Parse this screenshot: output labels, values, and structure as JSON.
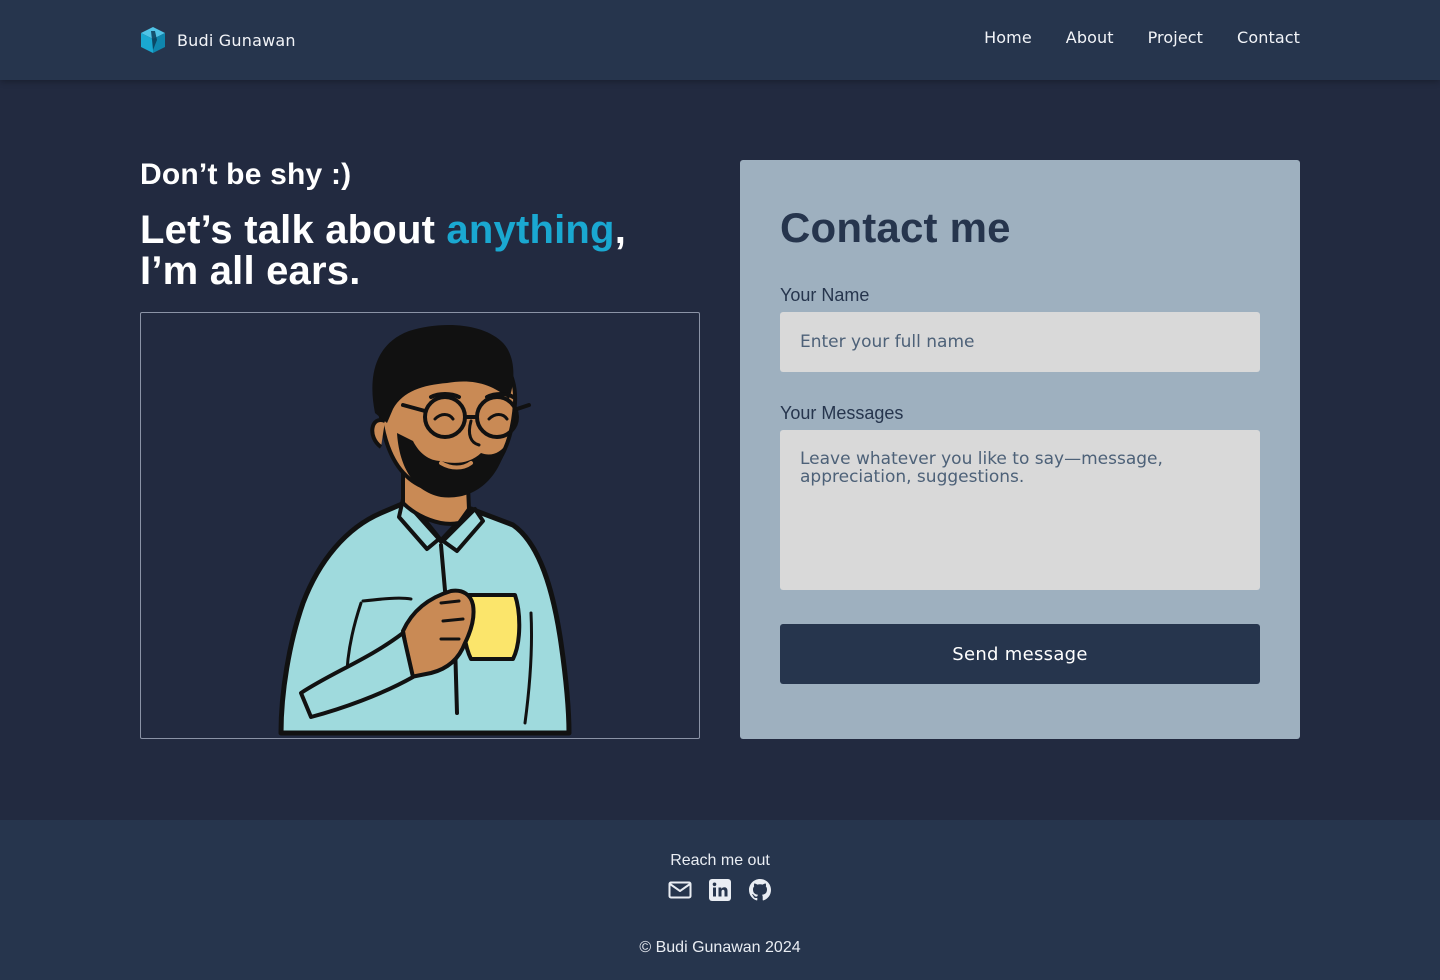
{
  "brand": {
    "name": "Budi Gunawan",
    "logo_icon": "cube-logo-icon",
    "logo_color": "#1aa8d1"
  },
  "nav": {
    "items": [
      {
        "label": "Home"
      },
      {
        "label": "About"
      },
      {
        "label": "Project"
      },
      {
        "label": "Contact"
      }
    ]
  },
  "hero": {
    "tagline": "Don’t be shy :)",
    "headline_prefix": "Let’s talk about ",
    "headline_accent": "anything",
    "headline_suffix": ",",
    "headline_line2": "I’m all ears.",
    "accent_color": "#1aa8d1",
    "illustration": "man-with-mug-illustration"
  },
  "contact_form": {
    "title": "Contact me",
    "name_label": "Your Name",
    "name_placeholder": "Enter your full name",
    "name_value": "",
    "message_label": "Your Messages",
    "message_placeholder": "Leave whatever you like to say—message, appreciation, suggestions.",
    "message_value": "",
    "submit_label": "Send message"
  },
  "footer": {
    "reach_label": "Reach me out",
    "socials": [
      {
        "icon": "mail-icon"
      },
      {
        "icon": "linkedin-icon"
      },
      {
        "icon": "github-icon"
      }
    ],
    "copyright": "© Budi Gunawan 2024"
  },
  "colors": {
    "page_bg": "#222a40",
    "header_bg": "#26354d",
    "card_bg": "#9eb0bf",
    "input_bg": "#d9d9d9",
    "button_bg": "#26354d"
  }
}
